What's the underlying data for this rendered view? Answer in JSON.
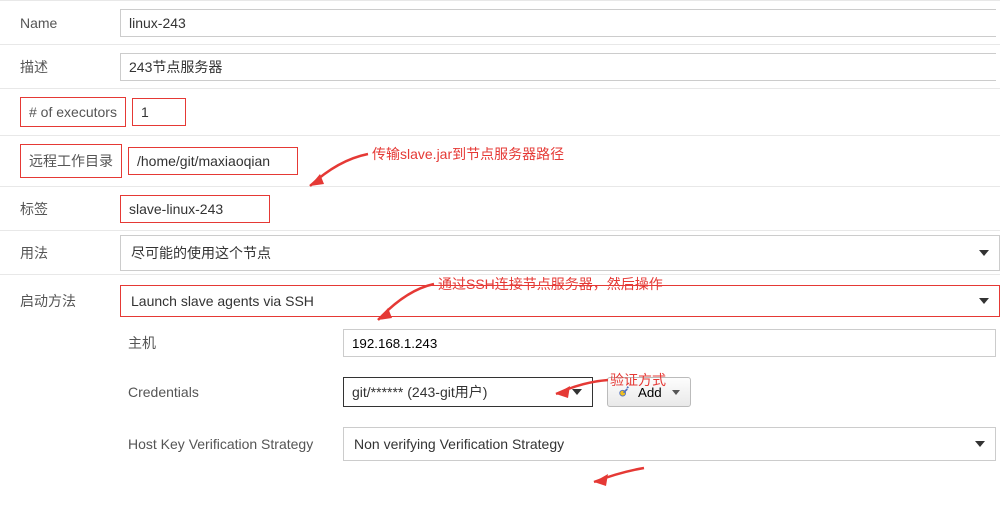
{
  "labels": {
    "name": "Name",
    "desc": "描述",
    "executors": "# of executors",
    "remoteDir": "远程工作目录",
    "tags": "标签",
    "usage": "用法",
    "launch": "启动方法",
    "host": "主机",
    "credentials": "Credentials",
    "hkvs": "Host Key Verification Strategy",
    "addBtn": "Add"
  },
  "values": {
    "name": "linux-243",
    "desc": "243节点服务器",
    "executors": "1",
    "remoteDir": "/home/git/maxiaoqian",
    "tags": "slave-linux-243",
    "usage": "尽可能的使用这个节点",
    "launch": "Launch slave agents via SSH",
    "host": "192.168.1.243",
    "credentials": "git/****** (243-git用户)",
    "hkvs": "Non verifying Verification Strategy"
  },
  "annotations": {
    "a1": "传输slave.jar到节点服务器路径",
    "a2": "通过SSH连接节点服务器，然后操作",
    "a3": "验证方式"
  }
}
